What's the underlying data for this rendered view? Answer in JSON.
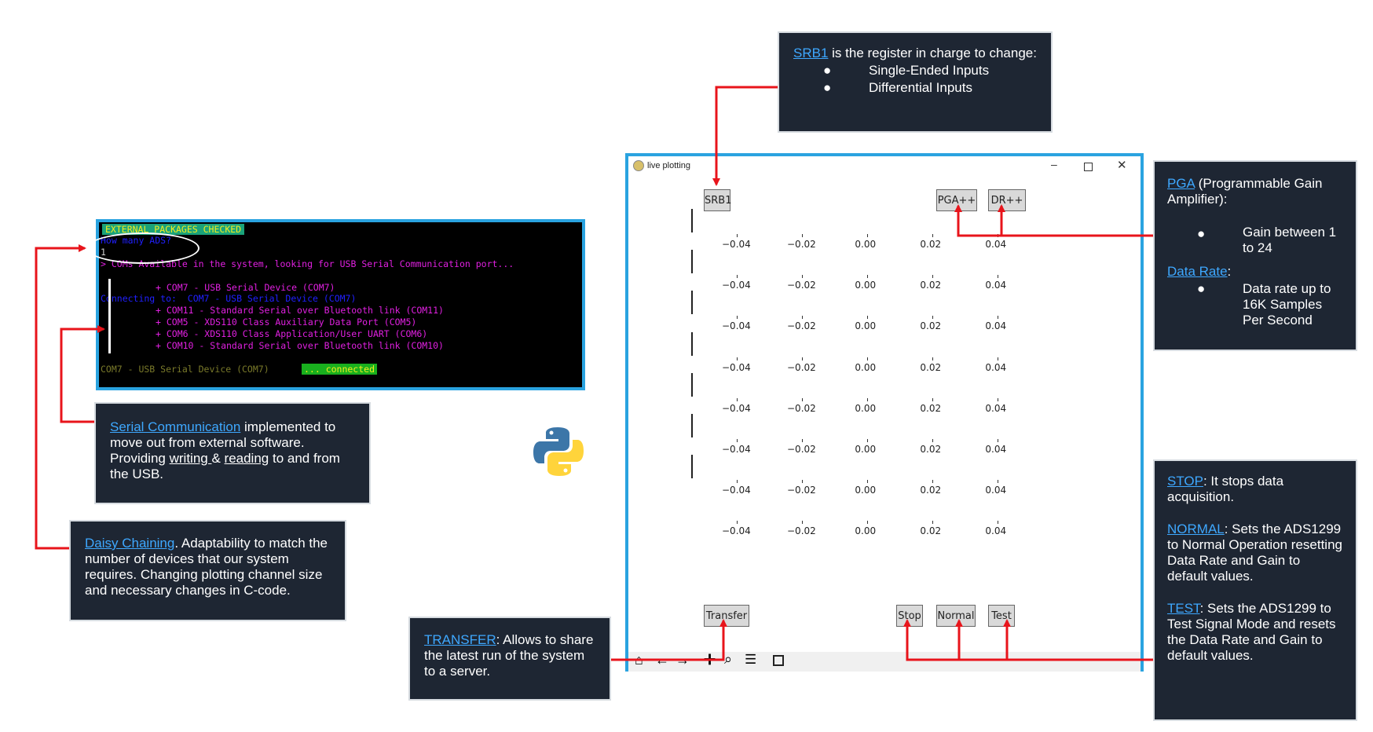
{
  "terminal": {
    "header": "EXTERNAL PACKAGES CHECKED",
    "prompt": "How many ADS?",
    "answer": "1",
    "coms_line": "> COMs Available in the system, looking for USB Serial Communication port...",
    "com_list": [
      "+ COM7 - USB Serial Device (COM7)",
      "+ COM11 - Standard Serial over Bluetooth link (COM11)",
      "+ COM5 - XDS110 Class Auxiliary Data Port (COM5)",
      "+ COM6 - XDS110 Class Application/User UART (COM6)",
      "+ COM10 - Standard Serial over Bluetooth link (COM10)"
    ],
    "connecting": "Connecting to:  COM7 - USB Serial Device (COM7)",
    "status_device": "COM7 - USB Serial Device (COM7)",
    "status_connected": "... connected"
  },
  "callouts": {
    "srb1": {
      "link": "SRB1",
      "text": " is the register in charge to change:",
      "bullets": [
        "Single-Ended Inputs",
        "Differential Inputs"
      ]
    },
    "pga": {
      "link": "PGA",
      "text": " (Programmable Gain Amplifier):",
      "bullet1": "Gain between 1 to 24",
      "link2": "Data Rate",
      "colon": ":",
      "bullet2": "Data rate up to 16K Samples Per Second"
    },
    "serial": {
      "link": "Serial Communication",
      "text1": " implemented to move out from external software. Providing ",
      "writing": "writing ",
      "amp": "& ",
      "reading": "reading",
      "text2": " to and from the USB."
    },
    "daisy": {
      "link": "Daisy Chaining",
      "text": ". Adaptability to match the number of devices that our system requires. Changing plotting channel size and necessary changes in C-code."
    },
    "transfer": {
      "link": "TRANSFER",
      "text": ": Allows to share the latest run of the system to a server."
    },
    "stop": {
      "link": "STOP",
      "text": ": It stops data acquisition.",
      "link2": "NORMAL",
      "text2": ": Sets the ADS1299 to Normal Operation resetting Data Rate and Gain to default values.",
      "link3": "TEST",
      "text3": ": Sets the ADS1299 to Test Signal Mode and resets the Data Rate and Gain to default values."
    }
  },
  "window": {
    "title": "live plotting",
    "buttons": {
      "srb1": "SRB1",
      "pga": "PGA++",
      "dr": "DR++",
      "transfer": "Transfer",
      "stop": "Stop",
      "normal": "Normal",
      "test": "Test"
    },
    "ticks": [
      "−0.04",
      "−0.02",
      "0.00",
      "0.02",
      "0.04"
    ]
  },
  "colors": {
    "panel": "#1e2633",
    "link": "#3ea8ff",
    "arrow": "#e8141b",
    "border": "#2aa3e0"
  }
}
